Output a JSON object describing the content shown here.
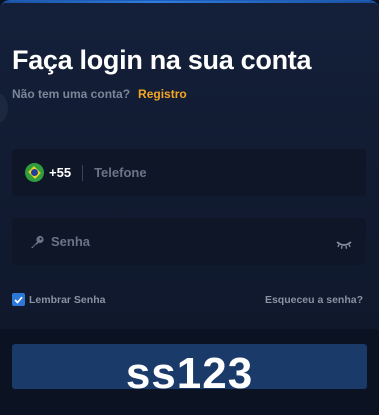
{
  "login": {
    "title": "Faça login na sua conta",
    "no_account_text": "Não tem uma conta?",
    "register_link": "Registro",
    "phone": {
      "country_code": "+55",
      "placeholder": "Telefone",
      "flag": "brazil-flag-icon"
    },
    "password": {
      "placeholder": "Senha",
      "icon": "key-icon",
      "toggle_icon": "eye-closed-icon"
    },
    "remember_label": "Lembrar Senha",
    "remember_checked": true,
    "forgot_link": "Esqueceu a senha?",
    "submit_label": ""
  },
  "overlay": {
    "watermark_text": "ss123"
  },
  "colors": {
    "accent_link": "#f5a623",
    "checkbox": "#2c78d8",
    "button": "#1a3a6a"
  }
}
